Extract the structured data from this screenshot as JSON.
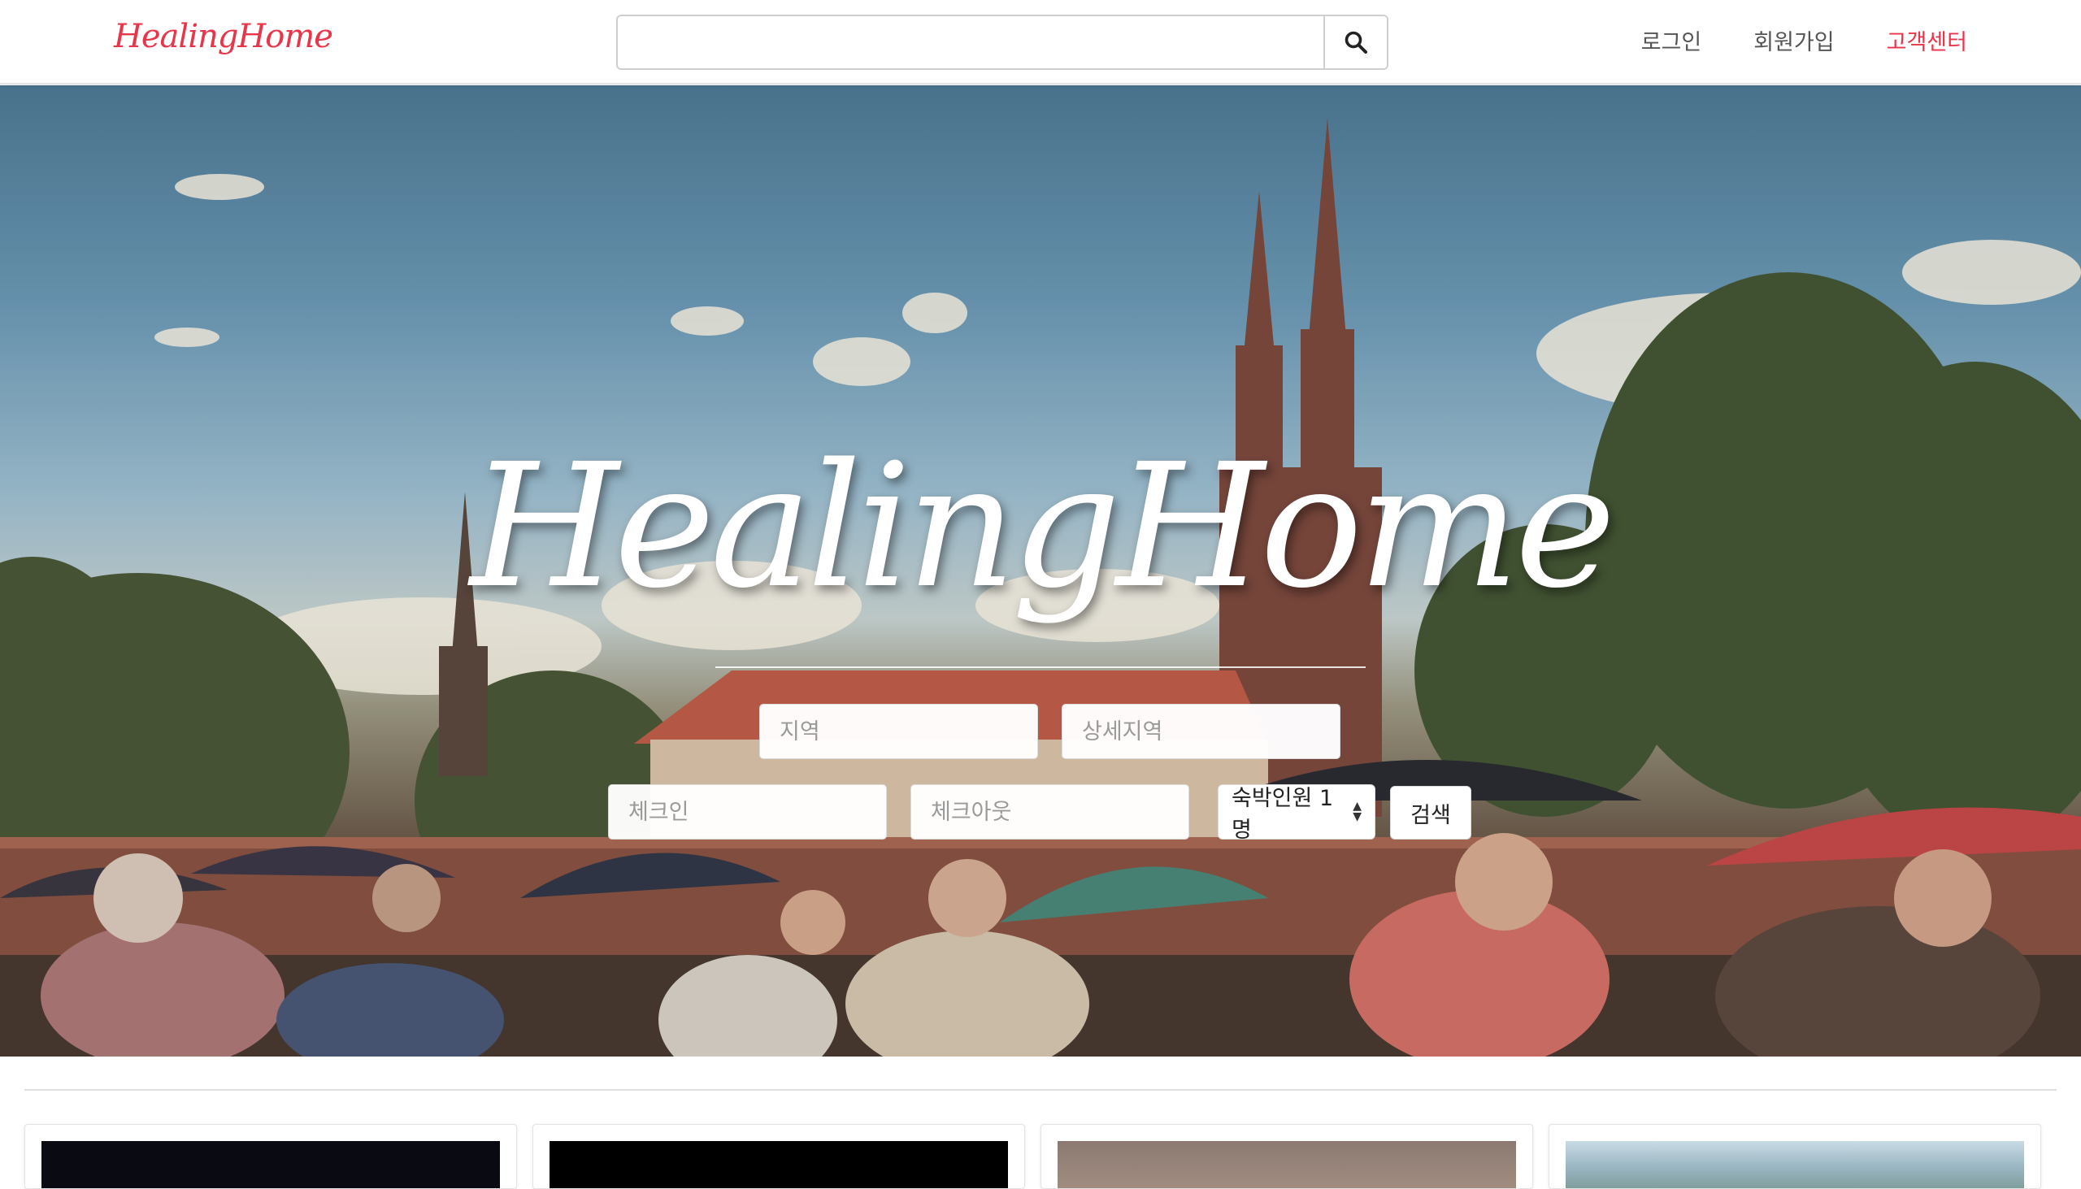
{
  "navbar": {
    "brand": "HealingHome",
    "search": {
      "value": "",
      "placeholder": ""
    },
    "links": [
      {
        "label": "로그인"
      },
      {
        "label": "회원가입"
      },
      {
        "label": "고객센터"
      }
    ],
    "accent_color": "#e8354a"
  },
  "hero": {
    "title": "HealingHome",
    "fields": {
      "region": {
        "placeholder": "지역"
      },
      "region_detail": {
        "placeholder": "상세지역"
      },
      "checkin": {
        "placeholder": "체크인"
      },
      "checkout": {
        "placeholder": "체크아웃"
      }
    },
    "guests": {
      "selected": "숙박인원 1명"
    },
    "search_button": "검색"
  },
  "listings": {
    "cards": [
      {
        "thumb_color": "#0a0a12"
      },
      {
        "thumb_color": "#000000"
      },
      {
        "thumb_color": "#8c7a72"
      },
      {
        "thumb_color": "#9ab6c4"
      }
    ]
  }
}
